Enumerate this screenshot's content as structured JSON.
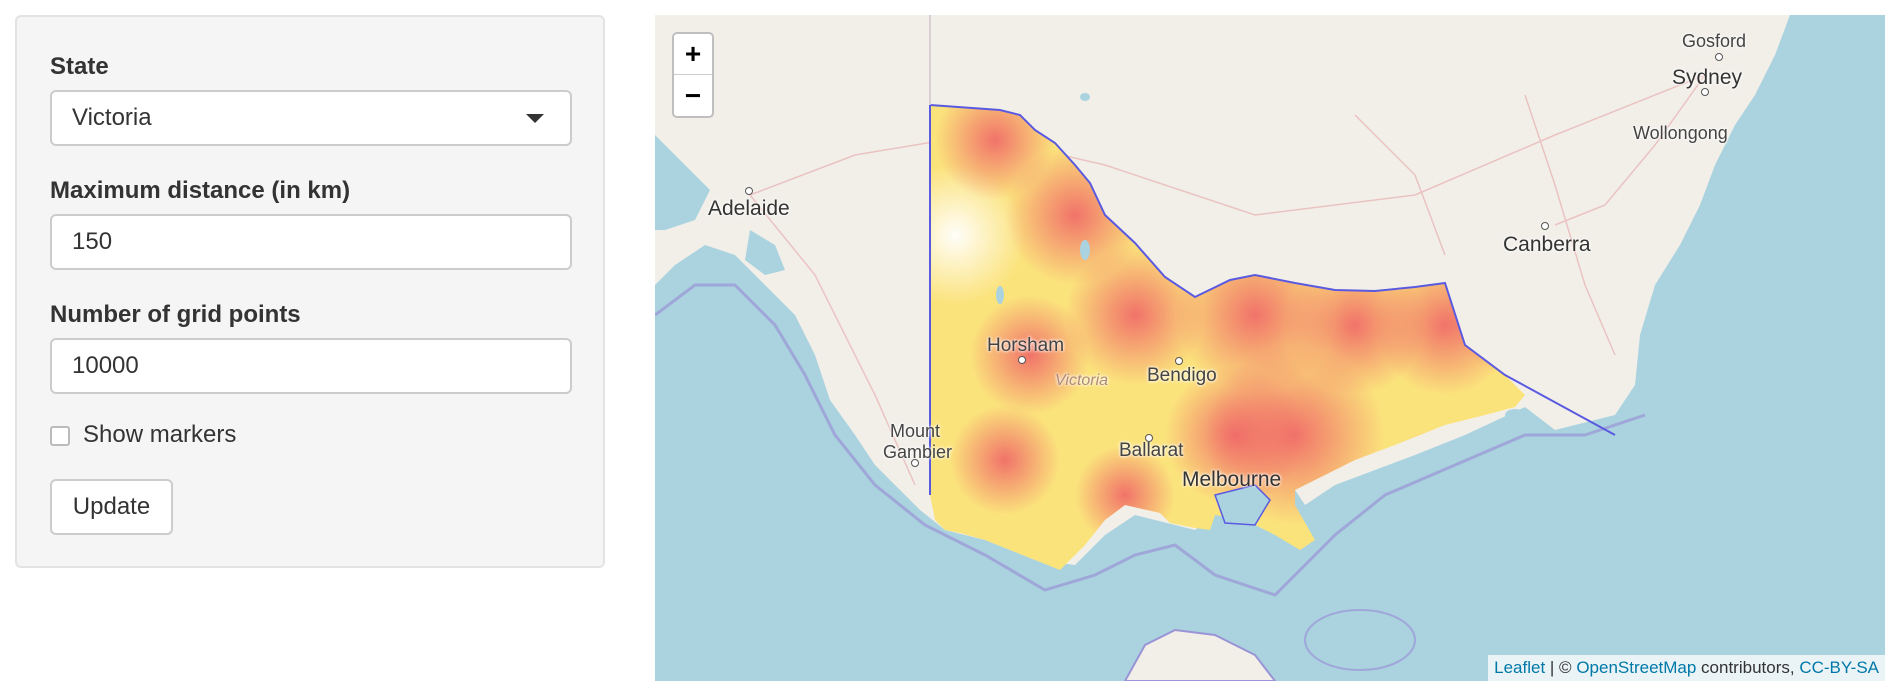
{
  "sidebar": {
    "state_label": "State",
    "state_value": "Victoria",
    "distance_label": "Maximum distance (in km)",
    "distance_value": "150",
    "grid_label": "Number of grid points",
    "grid_value": "10000",
    "markers_label": "Show markers",
    "markers_checked": false,
    "update_label": "Update"
  },
  "map": {
    "zoom_in": "+",
    "zoom_out": "−",
    "labels": {
      "gosford": "Gosford",
      "sydney": "Sydney",
      "wollongong": "Wollongong",
      "adelaide": "Adelaide",
      "canberra": "Canberra",
      "horsham": "Horsham",
      "victoria": "Victoria",
      "bendigo": "Bendigo",
      "mount": "Mount",
      "gambier": "Gambier",
      "ballarat": "Ballarat",
      "melbourne": "Melbourne"
    },
    "attribution": {
      "leaflet": "Leaflet",
      "sep": " | © ",
      "osm": "OpenStreetMap",
      "contributors": " contributors, ",
      "license": "CC-BY-SA"
    },
    "colors": {
      "water": "#aad3df",
      "land": "#f2efe9",
      "heat_low": "#fff27a",
      "heat_high": "#f06a6a",
      "border": "#5a5ae0"
    }
  }
}
